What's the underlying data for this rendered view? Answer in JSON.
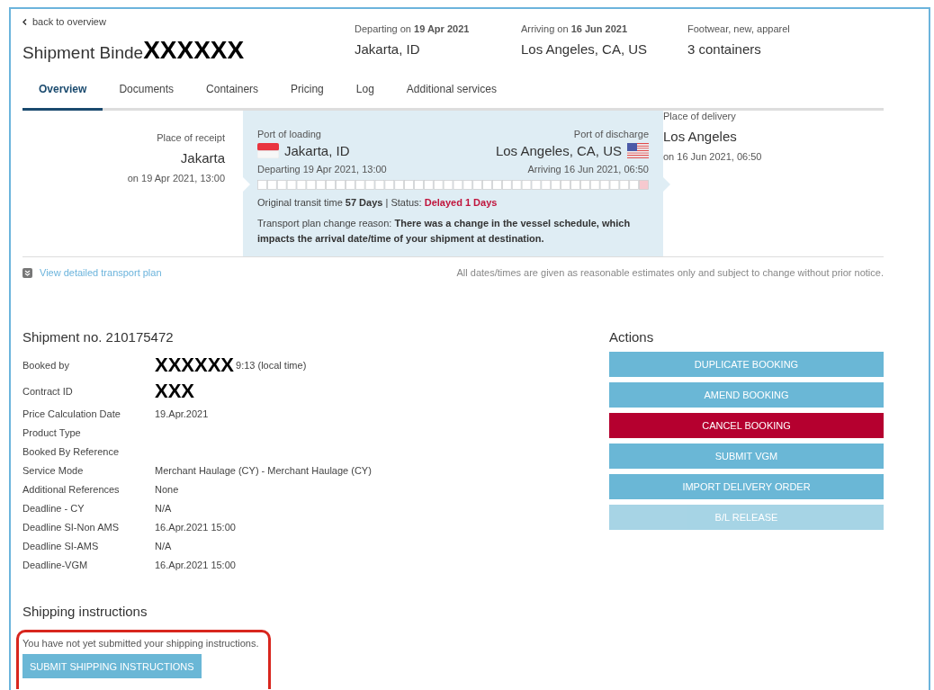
{
  "header": {
    "back_link": "back to overview",
    "title": "Shipment Binde",
    "title_redaction": "XXXXXX",
    "summary": [
      {
        "label": "Departing on **19 Apr 2021**",
        "value": "Jakarta, ID"
      },
      {
        "label": "Arriving on **16 Jun 2021**",
        "value": "Los Angeles, CA, US"
      },
      {
        "label": "Footwear, new, apparel",
        "value": "3 containers"
      }
    ]
  },
  "tabs": [
    {
      "label": "Overview",
      "selected": true
    },
    {
      "label": "Documents",
      "selected": false
    },
    {
      "label": "Containers",
      "selected": false
    },
    {
      "label": "Pricing",
      "selected": false
    },
    {
      "label": "Log",
      "selected": false
    },
    {
      "label": "Additional services",
      "selected": false
    }
  ],
  "route": {
    "receipt": {
      "label": "Place of receipt",
      "value": "Jakarta",
      "date": "on 19 Apr 2021, 13:00"
    },
    "loading": {
      "label": "Port of loading",
      "value": "Jakarta, ID",
      "time": "Departing 19 Apr 2021, 13:00"
    },
    "discharge": {
      "label": "Port of discharge",
      "value": "Los Angeles, CA, US",
      "time": "Arriving 16 Jun 2021, 06:50"
    },
    "delivery": {
      "label": "Place of delivery",
      "value": "Los Angeles",
      "date": "on 16 Jun 2021, 06:50"
    },
    "transit": "Original transit time **57 Days** | Status: ",
    "status": "Delayed 1 Days",
    "reason": "Transport plan change reason: **There was a change in the vessel schedule, which impacts the arrival date/time of your shipment at destination.**"
  },
  "plan_link": "View detailed transport plan",
  "disclaimer": "All dates/times are given as reasonable estimates only and subject to change without prior notice.",
  "shipment": {
    "title": "Shipment no. 210175472",
    "details": [
      {
        "label": "Booked by",
        "redaction": "XXXXXX",
        "value": "9:13 (local time)"
      },
      {
        "label": "Contract ID",
        "redaction": "XXX"
      },
      {
        "label": "Price Calculation Date",
        "value": "19.Apr.2021"
      },
      {
        "label": "Product Type"
      },
      {
        "label": "Booked By Reference"
      },
      {
        "label": "Service Mode",
        "value": "Merchant Haulage (CY) - Merchant Haulage (CY)"
      },
      {
        "label": "Additional References",
        "value": "None"
      },
      {
        "label": "Deadline - CY",
        "value": "N/A"
      },
      {
        "label": "Deadline SI-Non AMS",
        "value": "16.Apr.2021 15:00"
      },
      {
        "label": "Deadline SI-AMS",
        "value": "N/A"
      },
      {
        "label": "Deadline-VGM",
        "value": "16.Apr.2021 15:00"
      }
    ]
  },
  "actions": {
    "title": "Actions",
    "buttons": [
      {
        "label": "DUPLICATE BOOKING",
        "kind": "default",
        "disabled": false
      },
      {
        "label": "AMEND BOOKING",
        "kind": "default",
        "disabled": false
      },
      {
        "label": "CANCEL BOOKING",
        "kind": "danger",
        "disabled": false
      },
      {
        "label": "SUBMIT VGM",
        "kind": "default",
        "disabled": false
      },
      {
        "label": "IMPORT DELIVERY ORDER",
        "kind": "default",
        "disabled": false
      },
      {
        "label": "B/L RELEASE",
        "kind": "default",
        "disabled": true
      }
    ]
  },
  "shipping_instructions": {
    "title": "Shipping instructions",
    "message": "You have not yet submitted your shipping instructions.",
    "button": "SUBMIT SHIPPING INSTRUCTIONS"
  }
}
